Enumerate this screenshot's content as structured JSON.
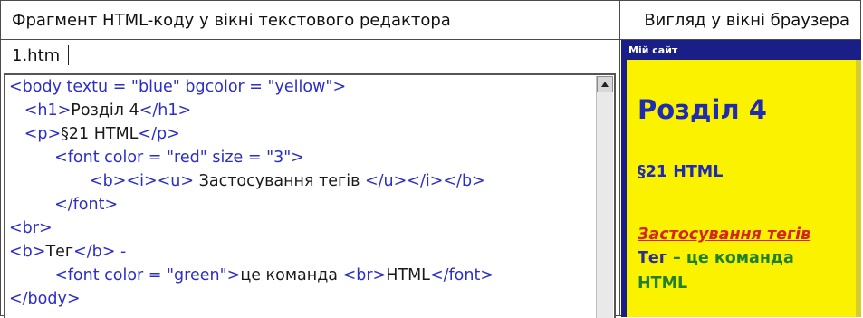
{
  "header": {
    "left": "Фрагмент HTML-коду у вікні текстового редактора",
    "right": "Вигляд у вікні браузера"
  },
  "editor": {
    "tab_label": "1.htm",
    "lines": [
      {
        "parts": [
          {
            "t": "tag",
            "v": "<body textu = \"blue\" bgcolor = \"yellow\">"
          }
        ]
      },
      {
        "parts": [
          {
            "t": "ws",
            "v": "   "
          },
          {
            "t": "tag",
            "v": "<h1>"
          },
          {
            "t": "txt",
            "v": "Розділ 4"
          },
          {
            "t": "tag",
            "v": "</h1>"
          }
        ]
      },
      {
        "parts": [
          {
            "t": "ws",
            "v": "   "
          },
          {
            "t": "tag",
            "v": "<p>"
          },
          {
            "t": "txt",
            "v": "§21 HTML"
          },
          {
            "t": "tag",
            "v": "</p>"
          }
        ]
      },
      {
        "parts": [
          {
            "t": "ws",
            "v": "         "
          },
          {
            "t": "tag",
            "v": "<font color = \"red\" size = \"3\">"
          }
        ]
      },
      {
        "parts": [
          {
            "t": "ws",
            "v": "                "
          },
          {
            "t": "tag",
            "v": "<b><i><u>"
          },
          {
            "t": "txt",
            "v": " Застосування тегів "
          },
          {
            "t": "tag",
            "v": "</u></i></b>"
          }
        ]
      },
      {
        "parts": [
          {
            "t": "ws",
            "v": "         "
          },
          {
            "t": "tag",
            "v": "</font>"
          }
        ]
      },
      {
        "parts": [
          {
            "t": "tag",
            "v": "<br>"
          }
        ]
      },
      {
        "parts": [
          {
            "t": "tag",
            "v": "<b>"
          },
          {
            "t": "txt",
            "v": "Тег"
          },
          {
            "t": "tag",
            "v": "</b> -"
          }
        ]
      },
      {
        "parts": [
          {
            "t": "ws",
            "v": "         "
          },
          {
            "t": "tag",
            "v": "<font color = \"green\">"
          },
          {
            "t": "txt",
            "v": "це команда "
          },
          {
            "t": "tag",
            "v": "<br>"
          },
          {
            "t": "txt",
            "v": "HTML"
          },
          {
            "t": "tag",
            "v": "</font>"
          }
        ]
      },
      {
        "parts": [
          {
            "t": "tag",
            "v": "</body>"
          }
        ]
      }
    ]
  },
  "browser": {
    "title": "Мій сайт",
    "heading": "Розділ 4",
    "paragraph": "§21 HTML",
    "red_text": "Застосування тегів",
    "teg_label": "Тег",
    "teg_rest": " – це команда",
    "html_line": "HTML"
  },
  "colors": {
    "tag": "#2b2ec8",
    "browser_bg": "#fbf200",
    "titlebar": "#1a1f88",
    "heading": "#1f2bb0",
    "red": "#d6231d",
    "green": "#21802a"
  }
}
